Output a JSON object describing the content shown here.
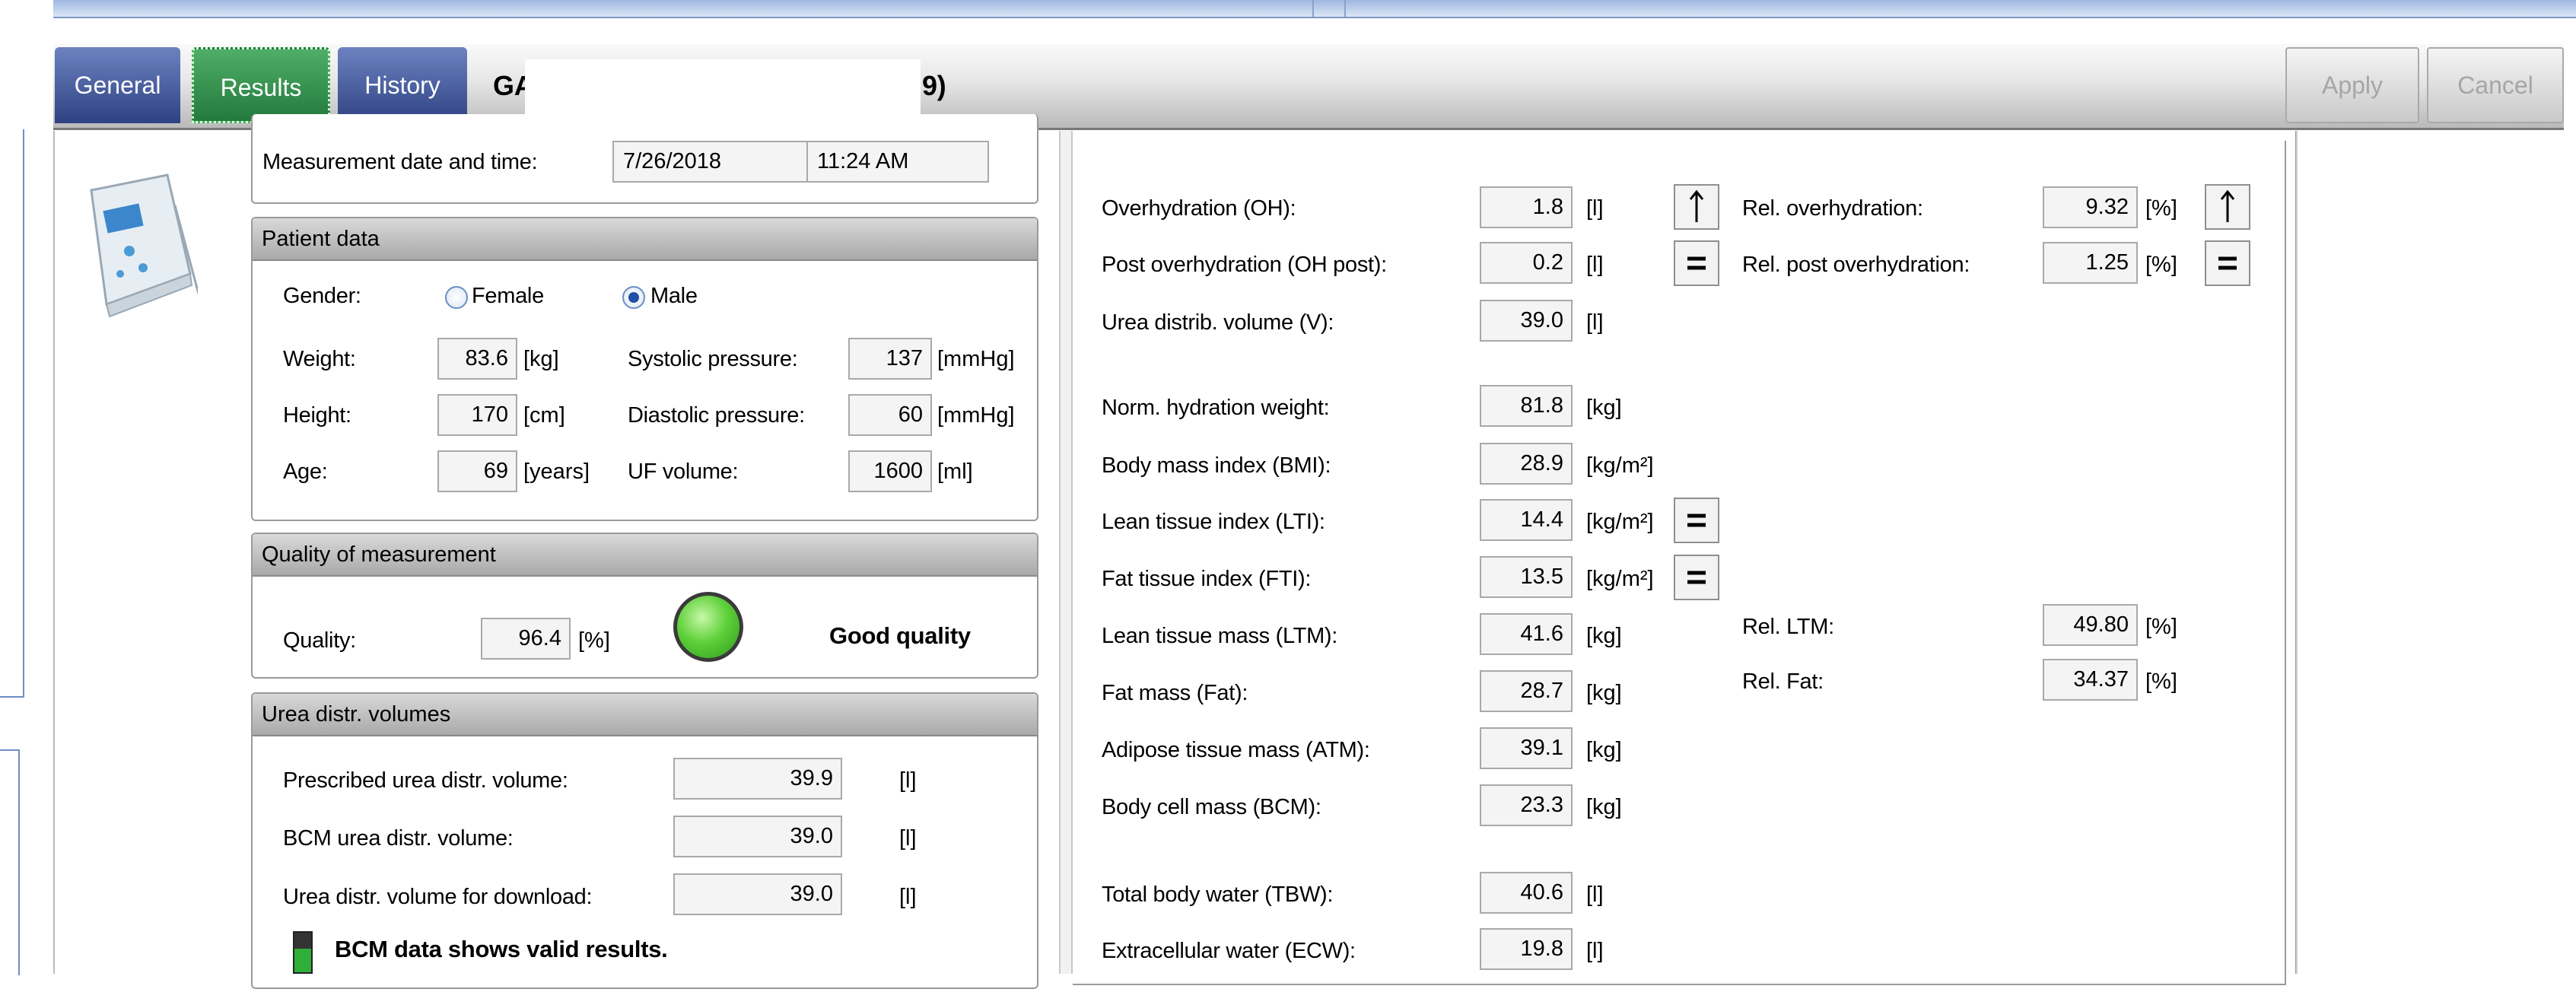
{
  "tabs": {
    "general": "General",
    "results": "Results",
    "history": "History"
  },
  "patient_header": {
    "name_start": "GA",
    "name_end": "9)"
  },
  "actions": {
    "apply": "Apply",
    "cancel": "Cancel"
  },
  "measurement": {
    "label": "Measurement date and time:",
    "date": "7/26/2018",
    "time": "11:24 AM"
  },
  "patient_data": {
    "title": "Patient data",
    "gender_label": "Gender:",
    "female": "Female",
    "male": "Male",
    "selected_gender": "Male",
    "weight_label": "Weight:",
    "weight": "83.6",
    "weight_unit": "[kg]",
    "height_label": "Height:",
    "height": "170",
    "height_unit": "[cm]",
    "age_label": "Age:",
    "age": "69",
    "age_unit": "[years]",
    "systolic_label": "Systolic pressure:",
    "systolic": "137",
    "systolic_unit": "[mmHg]",
    "diastolic_label": "Diastolic pressure:",
    "diastolic": "60",
    "diastolic_unit": "[mmHg]",
    "uf_label": "UF volume:",
    "uf": "1600",
    "uf_unit": "[ml]"
  },
  "quality": {
    "title": "Quality of measurement",
    "label": "Quality:",
    "value": "96.4",
    "unit": "[%]",
    "status": "Good quality",
    "indicator_color": "#5fd13a"
  },
  "urea": {
    "title": "Urea distr. volumes",
    "prescribed_label": "Prescribed urea distr. volume:",
    "prescribed": "39.9",
    "prescribed_unit": "[l]",
    "bcm_label": "BCM urea distr. volume:",
    "bcm": "39.0",
    "bcm_unit": "[l]",
    "download_label": "Urea distr. volume for download:",
    "download": "39.0",
    "download_unit": "[l]",
    "valid_msg": "BCM data shows valid results."
  },
  "results": {
    "oh": {
      "label": "Overhydration (OH):",
      "value": "1.8",
      "unit": "[l]",
      "indicator": "arrow-up"
    },
    "oh_post": {
      "label": "Post overhydration (OH post):",
      "value": "0.2",
      "unit": "[l]",
      "indicator": "equals"
    },
    "v": {
      "label": "Urea distrib. volume (V):",
      "value": "39.0",
      "unit": "[l]"
    },
    "nhw": {
      "label": "Norm. hydration weight:",
      "value": "81.8",
      "unit": "[kg]"
    },
    "bmi": {
      "label": "Body mass index (BMI):",
      "value": "28.9",
      "unit": "[kg/m²]"
    },
    "lti": {
      "label": "Lean tissue index (LTI):",
      "value": "14.4",
      "unit": "[kg/m²]",
      "indicator": "equals"
    },
    "fti": {
      "label": "Fat tissue index (FTI):",
      "value": "13.5",
      "unit": "[kg/m²]",
      "indicator": "equals"
    },
    "ltm": {
      "label": "Lean tissue mass (LTM):",
      "value": "41.6",
      "unit": "[kg]"
    },
    "fat": {
      "label": "Fat mass (Fat):",
      "value": "28.7",
      "unit": "[kg]"
    },
    "atm": {
      "label": "Adipose tissue mass (ATM):",
      "value": "39.1",
      "unit": "[kg]"
    },
    "bcm": {
      "label": "Body cell mass (BCM):",
      "value": "23.3",
      "unit": "[kg]"
    },
    "tbw": {
      "label": "Total body water (TBW):",
      "value": "40.6",
      "unit": "[l]"
    },
    "ecw": {
      "label": "Extracellular water (ECW):",
      "value": "19.8",
      "unit": "[l]"
    },
    "rel_oh": {
      "label": "Rel. overhydration:",
      "value": "9.32",
      "unit": "[%]",
      "indicator": "arrow-up"
    },
    "rel_oh_post": {
      "label": "Rel. post overhydration:",
      "value": "1.25",
      "unit": "[%]",
      "indicator": "equals"
    },
    "rel_ltm": {
      "label": "Rel. LTM:",
      "value": "49.80",
      "unit": "[%]"
    },
    "rel_fat": {
      "label": "Rel. Fat:",
      "value": "34.37",
      "unit": "[%]"
    }
  },
  "colors": {
    "tab_active": "#2f8a4a",
    "tab_inactive": "#3a4f8f"
  }
}
